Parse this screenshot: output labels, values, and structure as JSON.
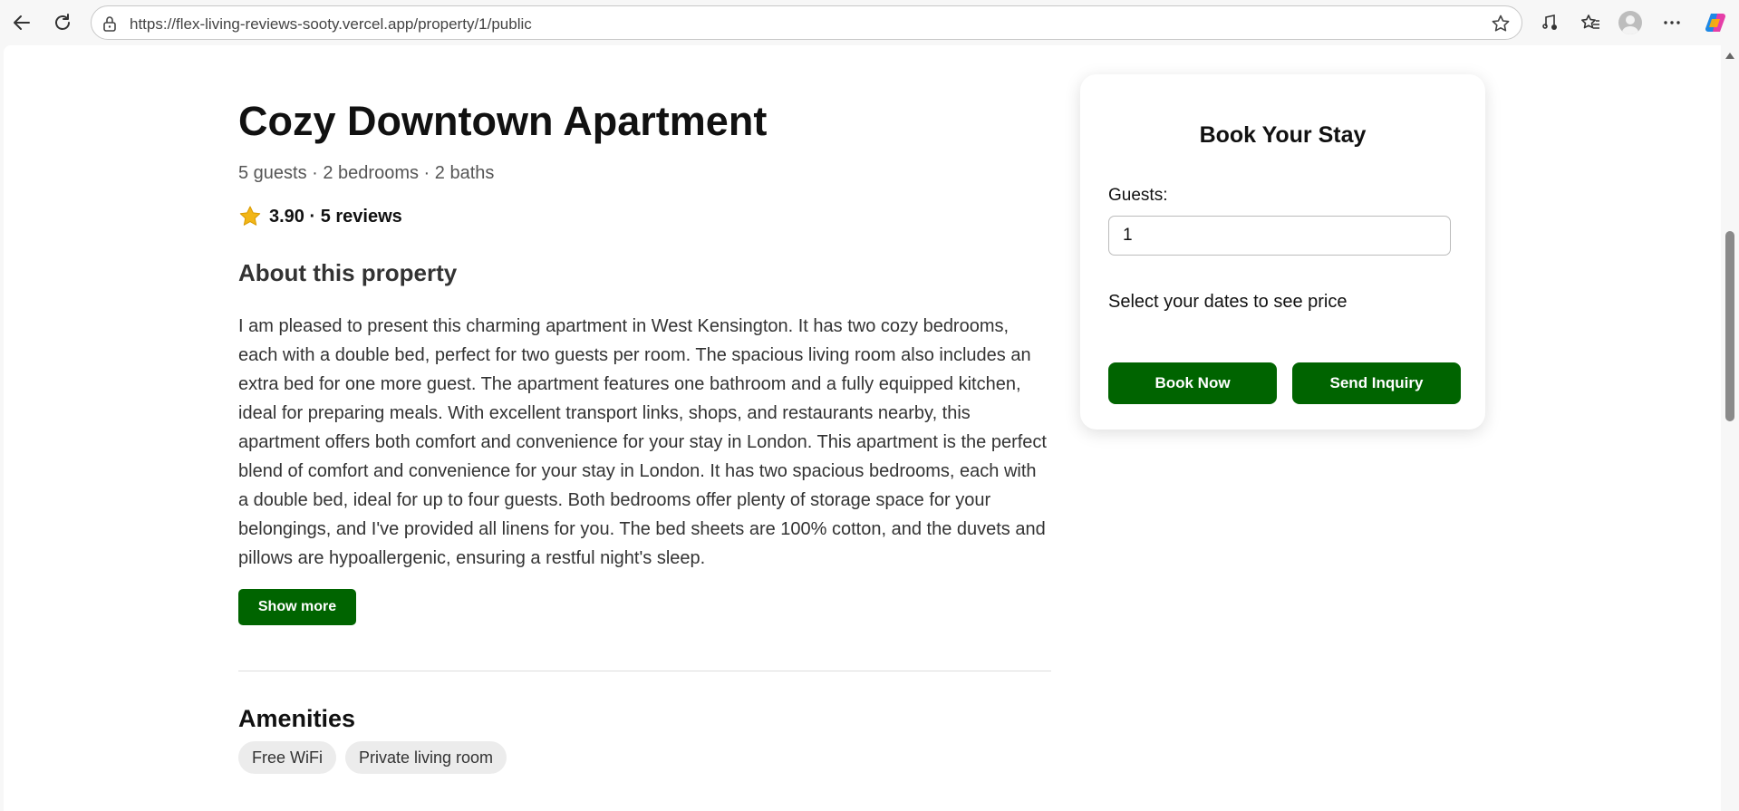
{
  "browser": {
    "url": "https://flex-living-reviews-sooty.vercel.app/property/1/public",
    "icons": [
      "back-icon",
      "refresh-icon",
      "lock-icon",
      "favorite-star-icon",
      "read-aloud-icon",
      "favorites-icon",
      "profile-icon",
      "more-icon",
      "copilot-icon"
    ]
  },
  "property": {
    "title": "Cozy Downtown Apartment",
    "specs": "5 guests · 2 bedrooms · 2 baths",
    "rating": "3.90 · 5 reviews",
    "about_heading": "About this property",
    "description": "I am pleased to present this charming apartment in West Kensington. It has two cozy bedrooms, each with a double bed, perfect for two guests per room. The spacious living room also includes an extra bed for one more guest. The apartment features one bathroom and a fully equipped kitchen, ideal for preparing meals. With excellent transport links, shops, and restaurants nearby, this apartment offers both comfort and convenience for your stay in London. This apartment is the perfect blend of comfort and convenience for your stay in London. It has two spacious bedrooms, each with a double bed, ideal for up to four guests. Both bedrooms offer plenty of storage space for your belongings, and I've provided all linens for you. The bed sheets are 100% cotton, and the duvets and pillows are hypoallergenic, ensuring a restful night's sleep.",
    "show_more_label": "Show more",
    "amenities_heading": "Amenities",
    "amenities": [
      "Free WiFi",
      "Private living room"
    ]
  },
  "booking": {
    "title": "Book Your Stay",
    "guests_label": "Guests:",
    "guests_value": "1",
    "price_text": "Select your dates to see price",
    "book_label": "Book Now",
    "inquiry_label": "Send Inquiry"
  },
  "colors": {
    "accent_green": "#006400",
    "star_gold": "#f2b616"
  }
}
